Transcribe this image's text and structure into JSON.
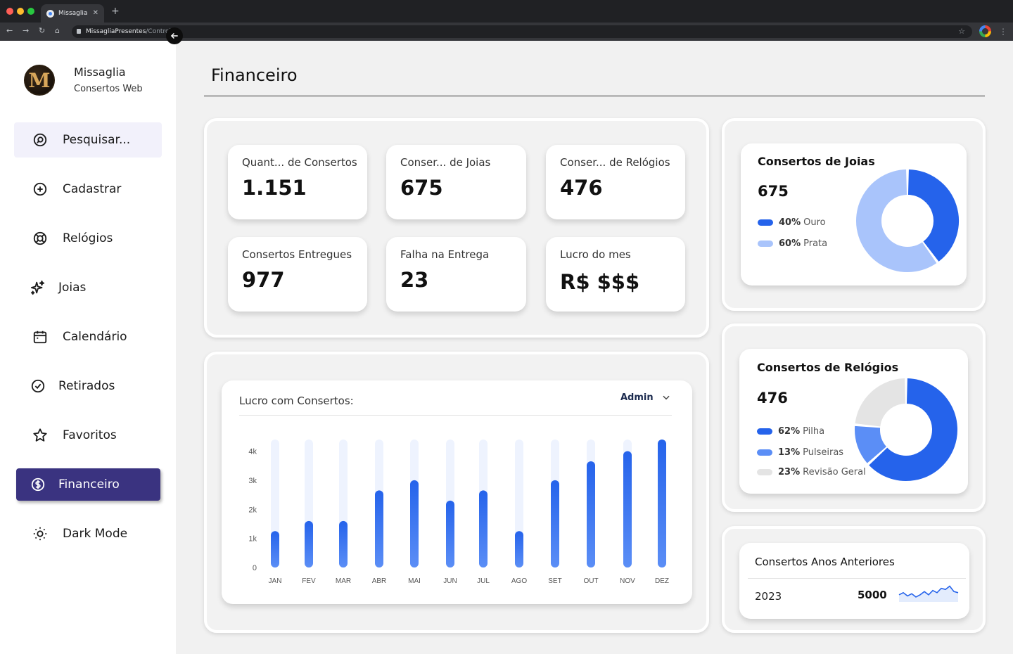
{
  "browser": {
    "tab_title": "Missaglia",
    "url_host": "MissagliaPresentes",
    "url_path": "/Controle"
  },
  "sidebar": {
    "logo_letter": "M",
    "brand_name": "Missaglia",
    "brand_sub": "Consertos Web",
    "items": [
      {
        "label": "Pesquisar...",
        "icon": "search-icon"
      },
      {
        "label": "Cadastrar",
        "icon": "plus-circle-icon"
      },
      {
        "label": "Relógios",
        "icon": "watch-icon"
      },
      {
        "label": "Joias",
        "icon": "sparkles-icon"
      },
      {
        "label": "Calendário",
        "icon": "calendar-icon"
      },
      {
        "label": "Retirados",
        "icon": "check-circle-icon"
      },
      {
        "label": "Favoritos",
        "icon": "star-icon"
      },
      {
        "label": "Financeiro",
        "icon": "dollar-circle-icon",
        "active": true
      },
      {
        "label": "Dark Mode",
        "icon": "sun-icon"
      }
    ]
  },
  "page": {
    "title": "Financeiro"
  },
  "stats": [
    {
      "label": "Quant... de Consertos",
      "value": "1.151"
    },
    {
      "label": "Conser... de Joias",
      "value": "675"
    },
    {
      "label": "Conser... de Relógios",
      "value": "476"
    },
    {
      "label": "Consertos Entregues",
      "value": "977"
    },
    {
      "label": "Falha na Entrega",
      "value": "23"
    },
    {
      "label": "Lucro do mes",
      "value": "R$ $$$"
    }
  ],
  "bar_chart": {
    "title": "Lucro com Consertos:",
    "filter": "Admin"
  },
  "joias": {
    "title": "Consertos de Joias",
    "total": "675",
    "legend": [
      {
        "pct": "40%",
        "label": "Ouro",
        "color": "#2563eb"
      },
      {
        "pct": "60%",
        "label": "Prata",
        "color": "#a9c4fb"
      }
    ]
  },
  "relogios": {
    "title": "Consertos de Relógios",
    "total": "476",
    "legend": [
      {
        "pct": "62%",
        "label": "Pilha",
        "color": "#2563eb"
      },
      {
        "pct": "13%",
        "label": "Pulseiras",
        "color": "#5b8ef6"
      },
      {
        "pct": "23%",
        "label": "Revisão Geral",
        "color": "#e4e4e4"
      }
    ]
  },
  "anos_anteriores": {
    "title": "Consertos Anos Anteriores",
    "year": "2023",
    "value": "5000",
    "sparkline": [
      22,
      24,
      21,
      23,
      20,
      22,
      25,
      22,
      26,
      24,
      28,
      27,
      30,
      25,
      24
    ]
  },
  "chart_data": [
    {
      "type": "bar",
      "title": "Lucro com Consertos:",
      "categories": [
        "JAN",
        "FEV",
        "MAR",
        "ABR",
        "MAI",
        "JUN",
        "JUL",
        "AGO",
        "SET",
        "OUT",
        "NOV",
        "DEZ"
      ],
      "values": [
        1250,
        1600,
        1600,
        2650,
        3000,
        2300,
        2650,
        1250,
        3000,
        3650,
        4000,
        4400
      ],
      "yticks": [
        "0",
        "1k",
        "2k",
        "3k",
        "4k"
      ],
      "ylim": [
        0,
        4400
      ],
      "color": "#2563eb",
      "grid": false
    },
    {
      "type": "pie",
      "title": "Consertos de Joias",
      "labels": [
        "Ouro",
        "Prata"
      ],
      "values": [
        40,
        60
      ],
      "colors": [
        "#2563eb",
        "#a9c4fb"
      ]
    },
    {
      "type": "pie",
      "title": "Consertos de Relógios",
      "labels": [
        "Pilha",
        "Pulseiras",
        "Revisão Geral"
      ],
      "values": [
        62,
        13,
        23
      ],
      "colors": [
        "#2563eb",
        "#5b8ef6",
        "#e4e4e4"
      ]
    }
  ]
}
